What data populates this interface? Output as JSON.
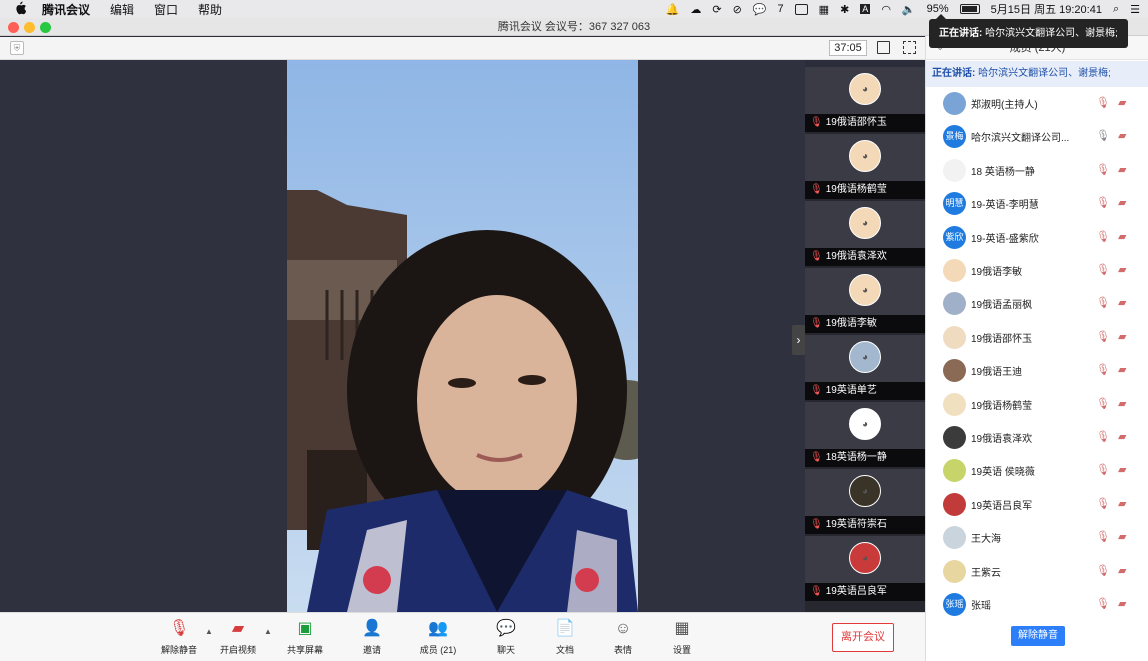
{
  "menubar": {
    "app_name": "腾讯会议",
    "items": [
      "编辑",
      "窗口",
      "帮助"
    ],
    "wechat_badge": "7",
    "battery": "95%",
    "datetime": "5月15日 周五  19:20:41"
  },
  "window": {
    "title": "腾讯会议 会议号：367 327 063",
    "timer": "37:05"
  },
  "video_strip": [
    {
      "name": "19俄语邵怀玉"
    },
    {
      "name": "19俄语杨鹤莹"
    },
    {
      "name": "19俄语袁泽欢"
    },
    {
      "name": "19俄语李敏"
    },
    {
      "name": "19英语单艺"
    },
    {
      "name": "18英语杨一静"
    },
    {
      "name": "19英语符崇石"
    },
    {
      "name": "19英语吕良军"
    }
  ],
  "toolbar": {
    "unmute_label": "解除静音",
    "start_video_label": "开启视频",
    "share_label": "共享屏幕",
    "invite_label": "邀请",
    "members_label": "成员 (21)",
    "chat_label": "聊天",
    "docs_label": "文档",
    "emoji_label": "表情",
    "settings_label": "设置",
    "leave_label": "离开会议"
  },
  "panel": {
    "header": "成员 (21人)",
    "speaking_prefix": "正在讲话:",
    "speaking_names": " 哈尔滨兴文翻译公司、谢景梅;",
    "unmute_all_label": "解除静音",
    "participants": [
      {
        "name": "郑淑明(主持人)",
        "avatar": "",
        "mic_on": false
      },
      {
        "name": "哈尔滨兴文翻译公司...",
        "avatar": "景梅",
        "mic_on": true
      },
      {
        "name": "18 英语杨一静",
        "avatar": "",
        "mic_on": false
      },
      {
        "name": "19-英语-李明慧",
        "avatar": "明慧",
        "mic_on": false
      },
      {
        "name": "19-英语-盛紫欣",
        "avatar": "紫欣",
        "mic_on": false
      },
      {
        "name": "19俄语李敏",
        "avatar": "",
        "mic_on": false
      },
      {
        "name": "19俄语孟丽枫",
        "avatar": "",
        "mic_on": false
      },
      {
        "name": "19俄语邵怀玉",
        "avatar": "",
        "mic_on": false
      },
      {
        "name": "19俄语王迪",
        "avatar": "",
        "mic_on": false
      },
      {
        "name": "19俄语杨鹤莹",
        "avatar": "",
        "mic_on": false
      },
      {
        "name": "19俄语袁泽欢",
        "avatar": "",
        "mic_on": false
      },
      {
        "name": "19英语 侯晓薇",
        "avatar": "",
        "mic_on": false
      },
      {
        "name": "19英语吕良军",
        "avatar": "",
        "mic_on": false
      },
      {
        "name": "王大海",
        "avatar": "",
        "mic_on": false
      },
      {
        "name": "王紫云",
        "avatar": "",
        "mic_on": false
      },
      {
        "name": "张瑶",
        "avatar": "张瑶",
        "mic_on": false
      }
    ]
  },
  "tooltip": {
    "prefix": "正在讲话:",
    "names": " 哈尔滨兴文翻译公司、谢景梅;"
  }
}
